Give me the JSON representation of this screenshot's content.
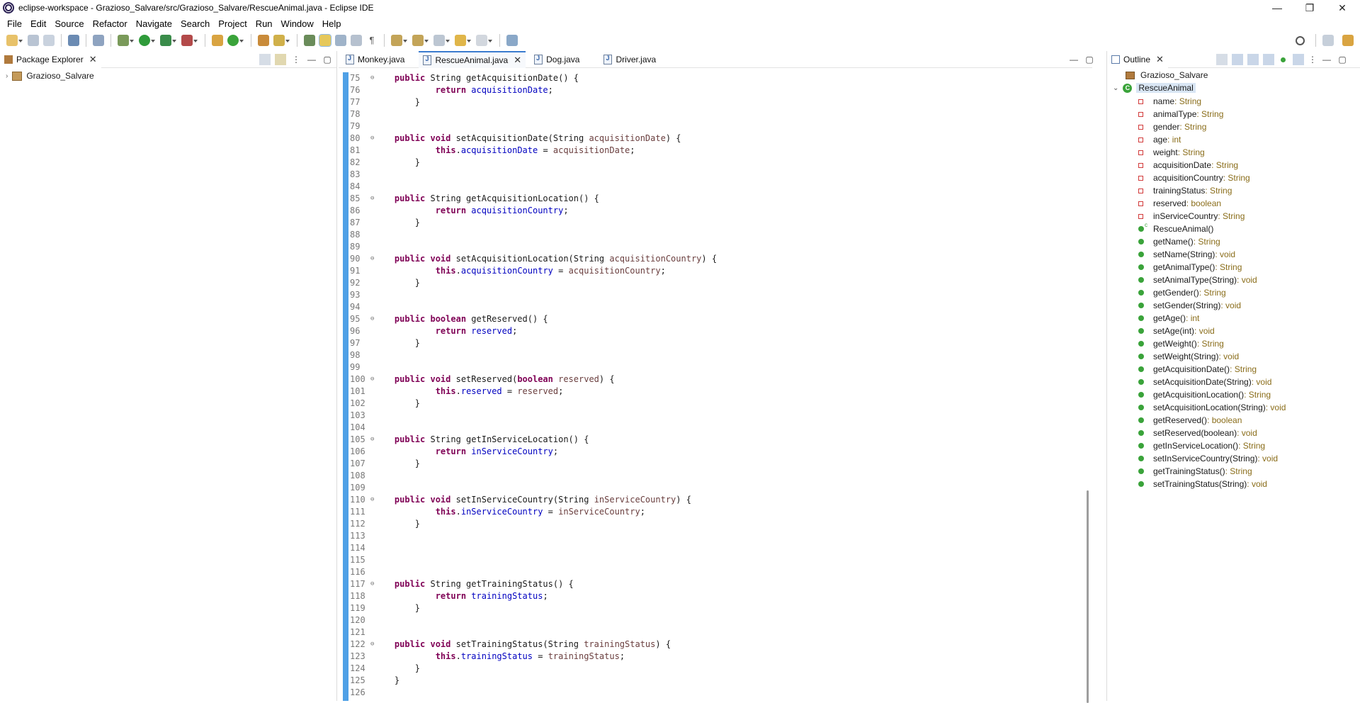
{
  "window": {
    "title": "eclipse-workspace - Grazioso_Salvare/src/Grazioso_Salvare/RescueAnimal.java - Eclipse IDE",
    "controls": [
      "—",
      "❐",
      "✕"
    ]
  },
  "menu": [
    "File",
    "Edit",
    "Source",
    "Refactor",
    "Navigate",
    "Search",
    "Project",
    "Run",
    "Window",
    "Help"
  ],
  "package_explorer": {
    "tab_label": "Package Explorer",
    "project": "Grazioso_Salvare"
  },
  "editor": {
    "tabs": [
      "Monkey.java",
      "RescueAnimal.java",
      "Dog.java",
      "Driver.java"
    ],
    "active_tab": "RescueAnimal.java",
    "lines": [
      {
        "n": "75",
        "fold": true,
        "tokens": [
          [
            "kw",
            "public "
          ],
          [
            "",
            "String getAcquisitionDate() {"
          ]
        ]
      },
      {
        "n": "76",
        "tokens": [
          [
            "",
            "        "
          ],
          [
            "kw",
            "return "
          ],
          [
            "fld",
            "acquisitionDate"
          ],
          [
            "",
            ";"
          ]
        ]
      },
      {
        "n": "77",
        "tokens": [
          [
            "",
            "    }"
          ]
        ]
      },
      {
        "n": "78",
        "tokens": []
      },
      {
        "n": "79",
        "tokens": []
      },
      {
        "n": "80",
        "fold": true,
        "tokens": [
          [
            "kw",
            "public void "
          ],
          [
            "",
            "setAcquisitionDate(String "
          ],
          [
            "par",
            "acquisitionDate"
          ],
          [
            "",
            ") {"
          ]
        ]
      },
      {
        "n": "81",
        "tokens": [
          [
            "",
            "        "
          ],
          [
            "kw",
            "this"
          ],
          [
            "",
            "."
          ],
          [
            "fld",
            "acquisitionDate"
          ],
          [
            "",
            " = "
          ],
          [
            "par",
            "acquisitionDate"
          ],
          [
            "",
            ";"
          ]
        ]
      },
      {
        "n": "82",
        "tokens": [
          [
            "",
            "    }"
          ]
        ]
      },
      {
        "n": "83",
        "tokens": []
      },
      {
        "n": "84",
        "tokens": []
      },
      {
        "n": "85",
        "fold": true,
        "tokens": [
          [
            "kw",
            "public "
          ],
          [
            "",
            "String getAcquisitionLocation() {"
          ]
        ]
      },
      {
        "n": "86",
        "tokens": [
          [
            "",
            "        "
          ],
          [
            "kw",
            "return "
          ],
          [
            "fld",
            "acquisitionCountry"
          ],
          [
            "",
            ";"
          ]
        ]
      },
      {
        "n": "87",
        "tokens": [
          [
            "",
            "    }"
          ]
        ]
      },
      {
        "n": "88",
        "tokens": []
      },
      {
        "n": "89",
        "tokens": []
      },
      {
        "n": "90",
        "fold": true,
        "tokens": [
          [
            "kw",
            "public void "
          ],
          [
            "",
            "setAcquisitionLocation(String "
          ],
          [
            "par",
            "acquisitionCountry"
          ],
          [
            "",
            ") {"
          ]
        ]
      },
      {
        "n": "91",
        "tokens": [
          [
            "",
            "        "
          ],
          [
            "kw",
            "this"
          ],
          [
            "",
            "."
          ],
          [
            "fld",
            "acquisitionCountry"
          ],
          [
            "",
            " = "
          ],
          [
            "par",
            "acquisitionCountry"
          ],
          [
            "",
            ";"
          ]
        ]
      },
      {
        "n": "92",
        "tokens": [
          [
            "",
            "    }"
          ]
        ]
      },
      {
        "n": "93",
        "tokens": []
      },
      {
        "n": "94",
        "tokens": []
      },
      {
        "n": "95",
        "fold": true,
        "tokens": [
          [
            "kw",
            "public boolean "
          ],
          [
            "",
            "getReserved() {"
          ]
        ]
      },
      {
        "n": "96",
        "tokens": [
          [
            "",
            "        "
          ],
          [
            "kw",
            "return "
          ],
          [
            "fld",
            "reserved"
          ],
          [
            "",
            ";"
          ]
        ]
      },
      {
        "n": "97",
        "tokens": [
          [
            "",
            "    }"
          ]
        ]
      },
      {
        "n": "98",
        "tokens": []
      },
      {
        "n": "99",
        "tokens": []
      },
      {
        "n": "100",
        "fold": true,
        "tokens": [
          [
            "kw",
            "public void "
          ],
          [
            "",
            "setReserved("
          ],
          [
            "kw",
            "boolean "
          ],
          [
            "par",
            "reserved"
          ],
          [
            "",
            ") {"
          ]
        ]
      },
      {
        "n": "101",
        "tokens": [
          [
            "",
            "        "
          ],
          [
            "kw",
            "this"
          ],
          [
            "",
            "."
          ],
          [
            "fld",
            "reserved"
          ],
          [
            "",
            " = "
          ],
          [
            "par",
            "reserved"
          ],
          [
            "",
            ";"
          ]
        ]
      },
      {
        "n": "102",
        "tokens": [
          [
            "",
            "    }"
          ]
        ]
      },
      {
        "n": "103",
        "tokens": []
      },
      {
        "n": "104",
        "tokens": []
      },
      {
        "n": "105",
        "fold": true,
        "tokens": [
          [
            "kw",
            "public "
          ],
          [
            "",
            "String getInServiceLocation() {"
          ]
        ]
      },
      {
        "n": "106",
        "tokens": [
          [
            "",
            "        "
          ],
          [
            "kw",
            "return "
          ],
          [
            "fld",
            "inServiceCountry"
          ],
          [
            "",
            ";"
          ]
        ]
      },
      {
        "n": "107",
        "tokens": [
          [
            "",
            "    }"
          ]
        ]
      },
      {
        "n": "108",
        "tokens": []
      },
      {
        "n": "109",
        "tokens": []
      },
      {
        "n": "110",
        "fold": true,
        "tokens": [
          [
            "kw",
            "public void "
          ],
          [
            "",
            "setInServiceCountry(String "
          ],
          [
            "par",
            "inServiceCountry"
          ],
          [
            "",
            ") {"
          ]
        ]
      },
      {
        "n": "111",
        "tokens": [
          [
            "",
            "        "
          ],
          [
            "kw",
            "this"
          ],
          [
            "",
            "."
          ],
          [
            "fld",
            "inServiceCountry"
          ],
          [
            "",
            " = "
          ],
          [
            "par",
            "inServiceCountry"
          ],
          [
            "",
            ";"
          ]
        ]
      },
      {
        "n": "112",
        "tokens": [
          [
            "",
            "    }"
          ]
        ]
      },
      {
        "n": "113",
        "tokens": []
      },
      {
        "n": "114",
        "tokens": []
      },
      {
        "n": "115",
        "tokens": []
      },
      {
        "n": "116",
        "tokens": []
      },
      {
        "n": "117",
        "fold": true,
        "tokens": [
          [
            "kw",
            "public "
          ],
          [
            "",
            "String getTrainingStatus() {"
          ]
        ]
      },
      {
        "n": "118",
        "tokens": [
          [
            "",
            "        "
          ],
          [
            "kw",
            "return "
          ],
          [
            "fld",
            "trainingStatus"
          ],
          [
            "",
            ";"
          ]
        ]
      },
      {
        "n": "119",
        "tokens": [
          [
            "",
            "    }"
          ]
        ]
      },
      {
        "n": "120",
        "tokens": []
      },
      {
        "n": "121",
        "tokens": []
      },
      {
        "n": "122",
        "fold": true,
        "tokens": [
          [
            "kw",
            "public void "
          ],
          [
            "",
            "setTrainingStatus(String "
          ],
          [
            "par",
            "trainingStatus"
          ],
          [
            "",
            ") {"
          ]
        ]
      },
      {
        "n": "123",
        "tokens": [
          [
            "",
            "        "
          ],
          [
            "kw",
            "this"
          ],
          [
            "",
            "."
          ],
          [
            "fld",
            "trainingStatus"
          ],
          [
            "",
            " = "
          ],
          [
            "par",
            "trainingStatus"
          ],
          [
            "",
            ";"
          ]
        ]
      },
      {
        "n": "124",
        "tokens": [
          [
            "",
            "    }"
          ]
        ]
      },
      {
        "n": "125",
        "tokens": [
          [
            "",
            "}"
          ]
        ]
      },
      {
        "n": "126",
        "tokens": []
      }
    ]
  },
  "outline": {
    "tab_label": "Outline",
    "package": "Grazioso_Salvare",
    "class_name": "RescueAnimal",
    "members": [
      {
        "kind": "field",
        "name": "name",
        "type": " : String"
      },
      {
        "kind": "field",
        "name": "animalType",
        "type": " : String"
      },
      {
        "kind": "field",
        "name": "gender",
        "type": " : String"
      },
      {
        "kind": "field",
        "name": "age",
        "type": " : int"
      },
      {
        "kind": "field",
        "name": "weight",
        "type": " : String"
      },
      {
        "kind": "field",
        "name": "acquisitionDate",
        "type": " : String"
      },
      {
        "kind": "field",
        "name": "acquisitionCountry",
        "type": " : String"
      },
      {
        "kind": "field",
        "name": "trainingStatus",
        "type": " : String"
      },
      {
        "kind": "field",
        "name": "reserved",
        "type": " : boolean"
      },
      {
        "kind": "field",
        "name": "inServiceCountry",
        "type": " : String"
      },
      {
        "kind": "ctor",
        "name": "RescueAnimal()",
        "type": ""
      },
      {
        "kind": "method",
        "name": "getName()",
        "type": " : String"
      },
      {
        "kind": "method",
        "name": "setName(String)",
        "type": " : void"
      },
      {
        "kind": "method",
        "name": "getAnimalType()",
        "type": " : String"
      },
      {
        "kind": "method",
        "name": "setAnimalType(String)",
        "type": " : void"
      },
      {
        "kind": "method",
        "name": "getGender()",
        "type": " : String"
      },
      {
        "kind": "method",
        "name": "setGender(String)",
        "type": " : void"
      },
      {
        "kind": "method",
        "name": "getAge()",
        "type": " : int"
      },
      {
        "kind": "method",
        "name": "setAge(int)",
        "type": " : void"
      },
      {
        "kind": "method",
        "name": "getWeight()",
        "type": " : String"
      },
      {
        "kind": "method",
        "name": "setWeight(String)",
        "type": " : void"
      },
      {
        "kind": "method",
        "name": "getAcquisitionDate()",
        "type": " : String"
      },
      {
        "kind": "method",
        "name": "setAcquisitionDate(String)",
        "type": " : void"
      },
      {
        "kind": "method",
        "name": "getAcquisitionLocation()",
        "type": " : String"
      },
      {
        "kind": "method",
        "name": "setAcquisitionLocation(String)",
        "type": " : void"
      },
      {
        "kind": "method",
        "name": "getReserved()",
        "type": " : boolean"
      },
      {
        "kind": "method",
        "name": "setReserved(boolean)",
        "type": " : void"
      },
      {
        "kind": "method",
        "name": "getInServiceLocation()",
        "type": " : String"
      },
      {
        "kind": "method",
        "name": "setInServiceCountry(String)",
        "type": " : void"
      },
      {
        "kind": "method",
        "name": "getTrainingStatus()",
        "type": " : String"
      },
      {
        "kind": "method",
        "name": "setTrainingStatus(String)",
        "type": " : void"
      }
    ]
  },
  "colors": {
    "keyword": "#7f0055",
    "field": "#0000c0",
    "parameter": "#6a3e3e",
    "ruler": "#4fa0e6",
    "type_label": "#8a6d1a"
  }
}
